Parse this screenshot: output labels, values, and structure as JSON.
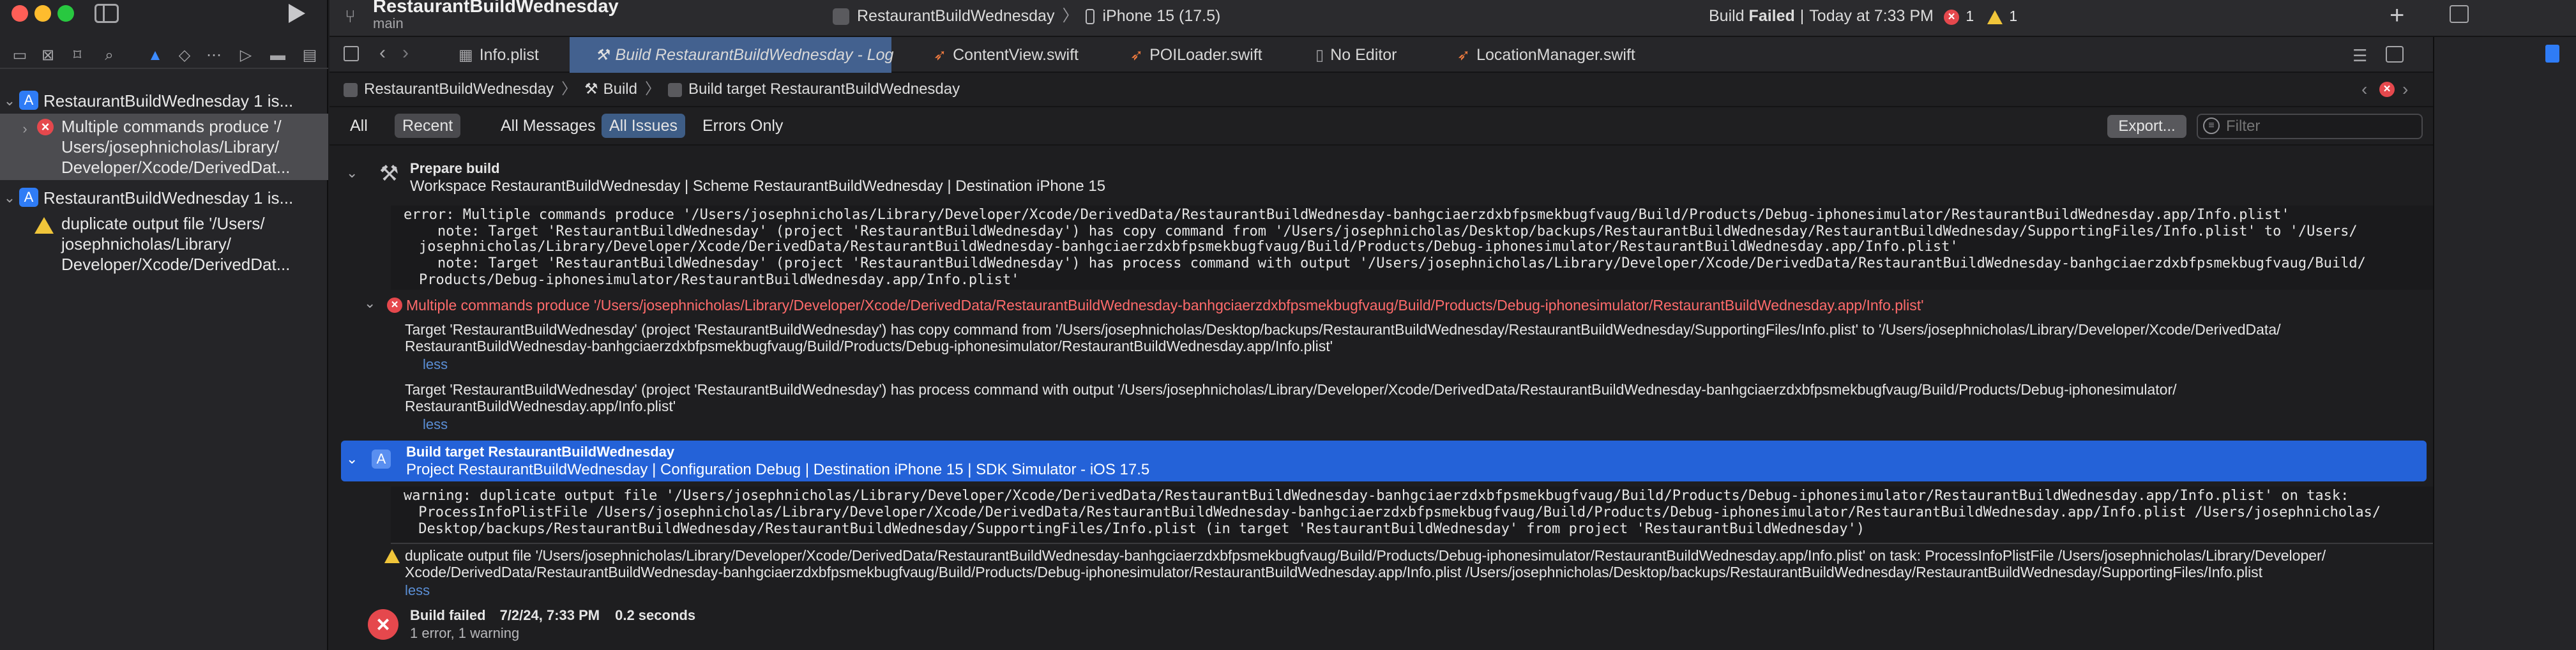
{
  "window": {
    "project_title": "RestaurantBuildWednesday",
    "branch": "main",
    "scheme": "RestaurantBuildWednesday",
    "destination": "iPhone 15 (17.5)",
    "status_prefix": "Build",
    "status_state": "Failed",
    "status_time": "Today at 7:33 PM",
    "error_count": "1",
    "warning_count": "1"
  },
  "navigator": {
    "items": [
      {
        "label": "RestaurantBuildWednesday 1 is...",
        "type": "project"
      },
      {
        "label_lines": [
          "Multiple commands produce '/",
          "Users/josephnicholas/Library/",
          "Developer/Xcode/DerivedDat..."
        ],
        "type": "error"
      },
      {
        "label": "RestaurantBuildWednesday 1 is...",
        "type": "project"
      },
      {
        "label_lines": [
          "duplicate output file '/Users/",
          "josephnicholas/Library/",
          "Developer/Xcode/DerivedDat..."
        ],
        "type": "warning"
      }
    ]
  },
  "tabs": [
    {
      "label": "Info.plist",
      "icon": "grid-icon"
    },
    {
      "label": "Build RestaurantBuildWednesday - Log",
      "icon": "hammer-icon",
      "active": true
    },
    {
      "label": "ContentView.swift",
      "icon": "swift-icon"
    },
    {
      "label": "POILoader.swift",
      "icon": "swift-icon"
    },
    {
      "label": "No Editor",
      "icon": "doc-icon"
    },
    {
      "label": "LocationManager.swift",
      "icon": "swift-icon"
    }
  ],
  "breadcrumb": [
    "RestaurantBuildWednesday",
    "Build",
    "Build target RestaurantBuildWednesday"
  ],
  "filters": {
    "scope_all": "All",
    "scope_recent": "Recent",
    "all_messages": "All Messages",
    "all_issues": "All Issues",
    "errors_only": "Errors Only",
    "export": "Export...",
    "filter_placeholder": "Filter"
  },
  "log": {
    "prepare": {
      "title": "Prepare build",
      "subtitle": "Workspace RestaurantBuildWednesday | Scheme RestaurantBuildWednesday | Destination iPhone 15",
      "raw_lines": [
        "error: Multiple commands produce '/Users/josephnicholas/Library/Developer/Xcode/DerivedData/RestaurantBuildWednesday-banhgciaerzdxbfpsmekbugfvaug/Build/Products/Debug-iphonesimulator/RestaurantBuildWednesday.app/Info.plist'",
        "    note: Target 'RestaurantBuildWednesday' (project 'RestaurantBuildWednesday') has copy command from '/Users/josephnicholas/Desktop/backups/RestaurantBuildWednesday/RestaurantBuildWednesday/SupportingFiles/Info.plist' to '/Users/",
        "josephnicholas/Library/Developer/Xcode/DerivedData/RestaurantBuildWednesday-banhgciaerzdxbfpsmekbugfvaug/Build/Products/Debug-iphonesimulator/RestaurantBuildWednesday.app/Info.plist'",
        "    note: Target 'RestaurantBuildWednesday' (project 'RestaurantBuildWednesday') has process command with output '/Users/josephnicholas/Library/Developer/Xcode/DerivedData/RestaurantBuildWednesday-banhgciaerzdxbfpsmekbugfvaug/Build/",
        "Products/Debug-iphonesimulator/RestaurantBuildWednesday.app/Info.plist'"
      ],
      "error_title": "Multiple commands produce '/Users/josephnicholas/Library/Developer/Xcode/DerivedData/RestaurantBuildWednesday-banhgciaerzdxbfpsmekbugfvaug/Build/Products/Debug-iphonesimulator/RestaurantBuildWednesday.app/Info.plist'",
      "note1": [
        "Target 'RestaurantBuildWednesday' (project 'RestaurantBuildWednesday') has copy command from '/Users/josephnicholas/Desktop/backups/RestaurantBuildWednesday/RestaurantBuildWednesday/SupportingFiles/Info.plist' to '/Users/josephnicholas/Library/Developer/Xcode/DerivedData/",
        "RestaurantBuildWednesday-banhgciaerzdxbfpsmekbugfvaug/Build/Products/Debug-iphonesimulator/RestaurantBuildWednesday.app/Info.plist'"
      ],
      "note2": [
        "Target 'RestaurantBuildWednesday' (project 'RestaurantBuildWednesday') has process command with output '/Users/josephnicholas/Library/Developer/Xcode/DerivedData/RestaurantBuildWednesday-banhgciaerzdxbfpsmekbugfvaug/Build/Products/Debug-iphonesimulator/",
        "RestaurantBuildWednesday.app/Info.plist'"
      ],
      "less": "less"
    },
    "target": {
      "title": "Build target RestaurantBuildWednesday",
      "subtitle": "Project RestaurantBuildWednesday | Configuration Debug | Destination iPhone 15 | SDK Simulator - iOS 17.5",
      "raw_lines": [
        "warning: duplicate output file '/Users/josephnicholas/Library/Developer/Xcode/DerivedData/RestaurantBuildWednesday-banhgciaerzdxbfpsmekbugfvaug/Build/Products/Debug-iphonesimulator/RestaurantBuildWednesday.app/Info.plist' on task:",
        " ProcessInfoPlistFile /Users/josephnicholas/Library/Developer/Xcode/DerivedData/RestaurantBuildWednesday-banhgciaerzdxbfpsmekbugfvaug/Build/Products/Debug-iphonesimulator/RestaurantBuildWednesday.app/Info.plist /Users/josephnicholas/",
        " Desktop/backups/RestaurantBuildWednesday/RestaurantBuildWednesday/SupportingFiles/Info.plist (in target 'RestaurantBuildWednesday' from project 'RestaurantBuildWednesday')"
      ],
      "warning_lines": [
        "duplicate output file '/Users/josephnicholas/Library/Developer/Xcode/DerivedData/RestaurantBuildWednesday-banhgciaerzdxbfpsmekbugfvaug/Build/Products/Debug-iphonesimulator/RestaurantBuildWednesday.app/Info.plist' on task: ProcessInfoPlistFile /Users/josephnicholas/Library/Developer/",
        "Xcode/DerivedData/RestaurantBuildWednesday-banhgciaerzdxbfpsmekbugfvaug/Build/Products/Debug-iphonesimulator/RestaurantBuildWednesday.app/Info.plist /Users/josephnicholas/Desktop/backups/RestaurantBuildWednesday/RestaurantBuildWednesday/SupportingFiles/Info.plist"
      ],
      "less": "less"
    },
    "result": {
      "title": "Build failed",
      "date": "7/2/24, 7:33 PM",
      "duration": "0.2 seconds",
      "summary": "1 error, 1 warning"
    }
  },
  "colors": {
    "error": "#e5484d",
    "warning": "#f0c53a",
    "selection": "#2462d8",
    "accent": "#2f7cf6"
  }
}
